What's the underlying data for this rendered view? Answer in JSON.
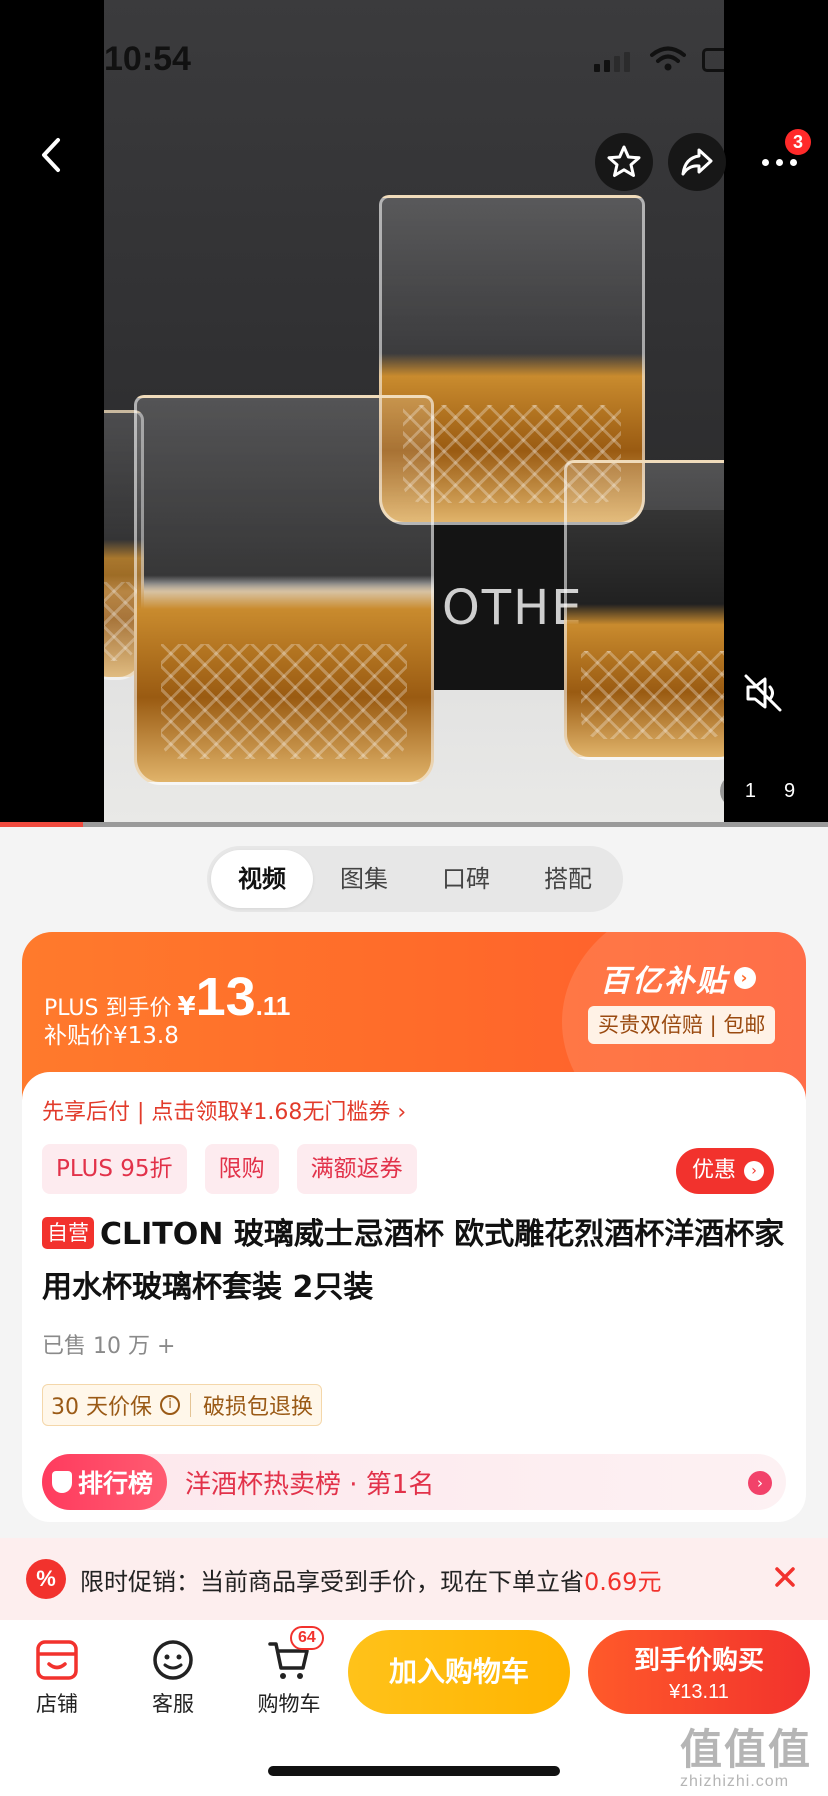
{
  "status_bar": {
    "time": "10:54"
  },
  "media": {
    "box_text": "OTHE",
    "page_current": "1",
    "page_total": "9",
    "video_progress": 0.1,
    "notification_count": "3"
  },
  "tabs": [
    {
      "label": "视频",
      "active": true
    },
    {
      "label": "图集",
      "active": false
    },
    {
      "label": "口碑",
      "active": false
    },
    {
      "label": "搭配",
      "active": false
    }
  ],
  "price": {
    "plus_label": "PLUS 到手价",
    "currency": "¥",
    "integer": "13",
    "decimal": ".11",
    "subsidy_price": "补贴价¥13.8",
    "brand": "百亿补贴",
    "guarantee": "买贵双倍赔 | 包邮"
  },
  "info": {
    "pay_later": "先享后付 | 点击领取¥1.68无门槛券 ›",
    "tags": [
      "PLUS 95折",
      "限购",
      "满额返券"
    ],
    "promo_button": "优惠",
    "self_tag": "自营",
    "title": "CLITON 玻璃威士忌酒杯 欧式雕花烈酒杯洋酒杯家用水杯玻璃杯套装 2只装",
    "sold": "已售 10 万 +",
    "price_protect": "30 天价保",
    "damage_return": "破损包退换",
    "rank_badge": "排行榜",
    "rank_text": "洋酒杯热卖榜 · 第1名"
  },
  "promo_strip": {
    "prefix": "限时促销：当前商品享受到手价，现在下单立省",
    "amount": "0.69元"
  },
  "bottom_bar": {
    "store": "店铺",
    "service": "客服",
    "cart": "购物车",
    "cart_count": "64",
    "add_to_cart": "加入购物车",
    "buy_line1": "到手价购买",
    "buy_line2": "¥13.11"
  },
  "watermark": {
    "cn": "值值值",
    "domain": "zhizhizhi.com"
  },
  "colors": {
    "accent": "#f2322d",
    "orange": "#ff6a2a",
    "yellow": "#ffb400"
  }
}
